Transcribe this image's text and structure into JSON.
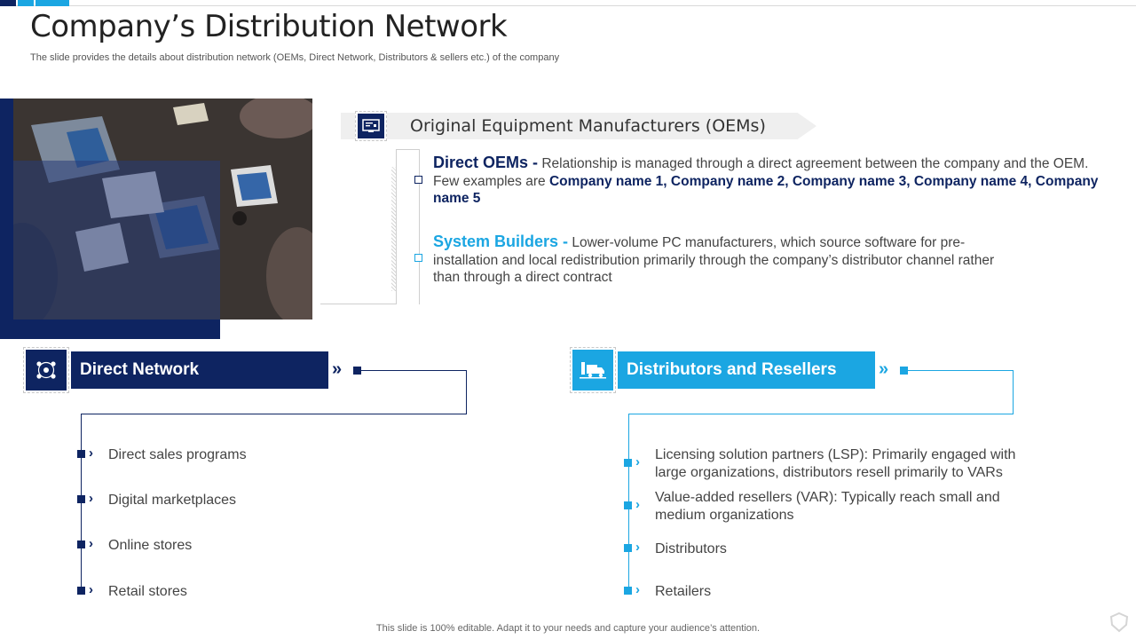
{
  "slide": {
    "title": "Company’s Distribution Network",
    "subtitle": "The slide provides the details about distribution network (OEMs, Direct Network, Distributors & sellers etc.) of the company",
    "footer": "This slide is 100% editable. Adapt it to your needs and capture your audience’s attention."
  },
  "colors": {
    "navy": "#0e2461",
    "sky": "#1ba6e2",
    "text": "#444444"
  },
  "oem": {
    "title": "Original Equipment Manufacturers (OEMs)",
    "icon": "computer-icon",
    "items": [
      {
        "heading": "Direct OEMs -",
        "text": " Relationship is managed through  a direct agreement between the company and the OEM. Few examples are ",
        "bold": "Company name 1, Company name 2, Company name 3, Company name 4, Company name 5"
      },
      {
        "heading": "System Builders -",
        "text": " Lower-volume  PC manufacturers,  which source software for pre-installation and local redistribution primarily through  the company’s distributor channel rather than through  a direct contract"
      }
    ]
  },
  "direct_network": {
    "title": "Direct Network",
    "icon": "network-people-icon",
    "items": [
      "Direct sales programs",
      "Digital marketplaces",
      "Online stores",
      "Retail stores"
    ]
  },
  "distributors": {
    "title": "Distributors and Resellers",
    "icon": "delivery-truck-icon",
    "items": [
      "Licensing solution partners (LSP): Primarily engaged with large organizations, distributors resell primarily to VARs",
      "Value-added resellers (VAR): Typically  reach small and medium organizations",
      "Distributors",
      "Retailers"
    ]
  }
}
